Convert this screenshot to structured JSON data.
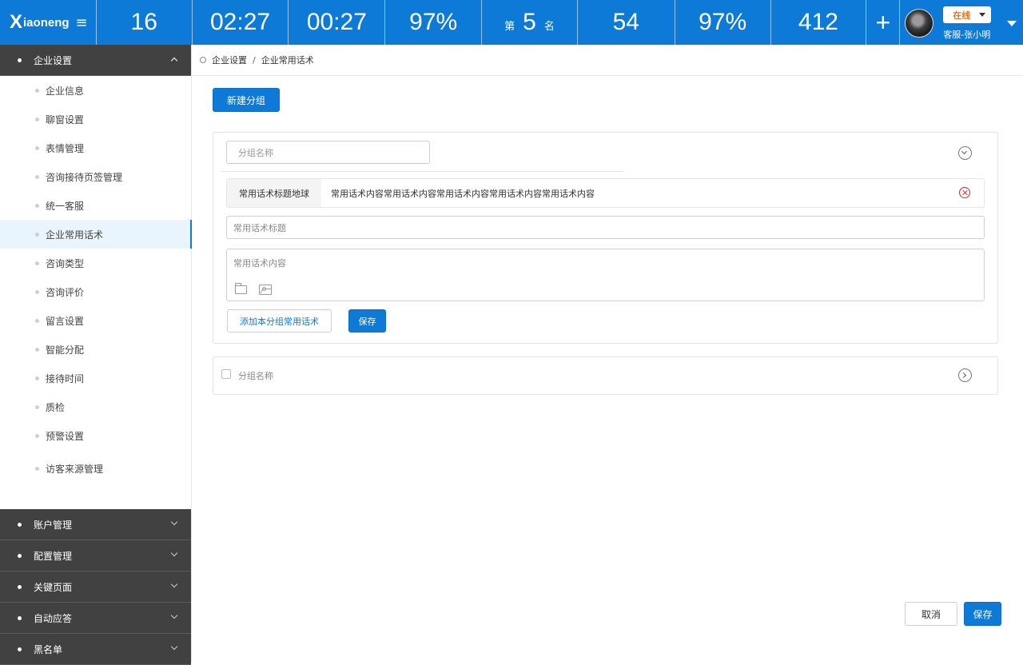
{
  "header": {
    "logo_mark": "X",
    "logo_text": "iaoneng",
    "menu_icon": "hamburger-icon",
    "stats": [
      "16",
      "02:27",
      "00:27",
      "97%",
      "5",
      "54",
      "97%",
      "412"
    ],
    "rank_prefix": "第",
    "rank_suffix": "名",
    "plus_label": "+",
    "status_label": "在线",
    "user_name": "客服-张小明"
  },
  "sidebar": {
    "open_section": "企业设置",
    "items": [
      {
        "label": "企业信息"
      },
      {
        "label": "聊窗设置"
      },
      {
        "label": "表情管理"
      },
      {
        "label": "咨询接待页签管理"
      },
      {
        "label": "统一客服"
      },
      {
        "label": "企业常用话术"
      },
      {
        "label": "咨询类型"
      },
      {
        "label": "咨询评价"
      },
      {
        "label": "留言设置"
      },
      {
        "label": "智能分配"
      },
      {
        "label": "接待时间"
      },
      {
        "label": "质检"
      },
      {
        "label": "预警设置"
      },
      {
        "label": "访客来源管理"
      }
    ],
    "active_item": "企业常用话术",
    "collapsed_sections": [
      "账户管理",
      "配置管理",
      "关键页面",
      "自动应答",
      "黑名单"
    ]
  },
  "breadcrumb": {
    "root": "企业设置",
    "separator": "/",
    "current": "企业常用话术"
  },
  "actions": {
    "new_group": "新建分组",
    "cancel": "取消",
    "save": "保存"
  },
  "group_panel": {
    "name_placeholder": "分组名称",
    "phrase": {
      "title": "常用话术标题地球",
      "content": "常用话术内容常用话术内容常用话术内容常用话术内容常用话术内容"
    },
    "title_placeholder": "常用话术标题",
    "content_placeholder": "常用话术内容",
    "add_button": "添加本分组常用话术",
    "save_button": "保存"
  },
  "collapsed_group": {
    "label": "分组名称"
  },
  "colors": {
    "primary": "#0c7ad6",
    "sidebar_dark": "#414141",
    "danger": "#e0262b",
    "status": "#e8721a"
  }
}
